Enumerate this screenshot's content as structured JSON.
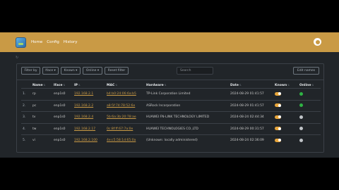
{
  "nav": {
    "links": [
      "Home",
      "Config",
      "History"
    ]
  },
  "toolbar": {
    "filter_by": "Filter by",
    "face": "Iface ▾",
    "known": "Known ▾",
    "online": "Online ▾",
    "reset": "Reset filter",
    "search_placeholder": "Search",
    "edit_names": "Edit names"
  },
  "table": {
    "headers": [
      "",
      "Name",
      "Iface",
      "IP",
      "MAC",
      "Hardware",
      "Date",
      "Known",
      "Online"
    ],
    "rows": [
      {
        "idx": "1.",
        "name": "rp",
        "iface": "enp1s0",
        "ip": "192.168.2.1",
        "mac": "b4:b0:24:06:6a:b5",
        "hardware": "TP-Link Corporation Limited",
        "date": "2024-08-29 01:41:57",
        "known": true,
        "online": "#2fb344"
      },
      {
        "idx": "2.",
        "name": "pc",
        "iface": "enp1s0",
        "ip": "192.168.2.2",
        "mac": "a8:5f:74:78:52:6e",
        "hardware": "ASRock Incorporation",
        "date": "2024-08-29 01:41:57",
        "known": true,
        "online": "#2fb344"
      },
      {
        "idx": "3.",
        "name": "tv",
        "iface": "enp1s0",
        "ip": "192.168.2.4",
        "mac": "5b:6a:3b:20:78:ae",
        "hardware": "HUAWEI FN-LINK TECHNOLOGY LIMITED",
        "date": "2024-08-24 02:44:34",
        "known": true,
        "online": "#c0c4c8"
      },
      {
        "idx": "4.",
        "name": "tw",
        "iface": "enp1s0",
        "ip": "192.168.2.17",
        "mac": "0c:8f:ff:67:7a:0e",
        "hardware": "HUAWEI TECHNOLOGIES CO.,LTD",
        "date": "2024-08-29 00:31:57",
        "known": true,
        "online": "#c0c4c8"
      },
      {
        "idx": "5.",
        "name": "vi",
        "iface": "enp1s0",
        "ip": "192.168.2.100",
        "mac": "4e:c5:58:1d:65:0a",
        "hardware": "(Unknown: locally administered)",
        "date": "2024-08-24 02:36:09",
        "known": true,
        "online": "#c0c4c8"
      }
    ]
  }
}
